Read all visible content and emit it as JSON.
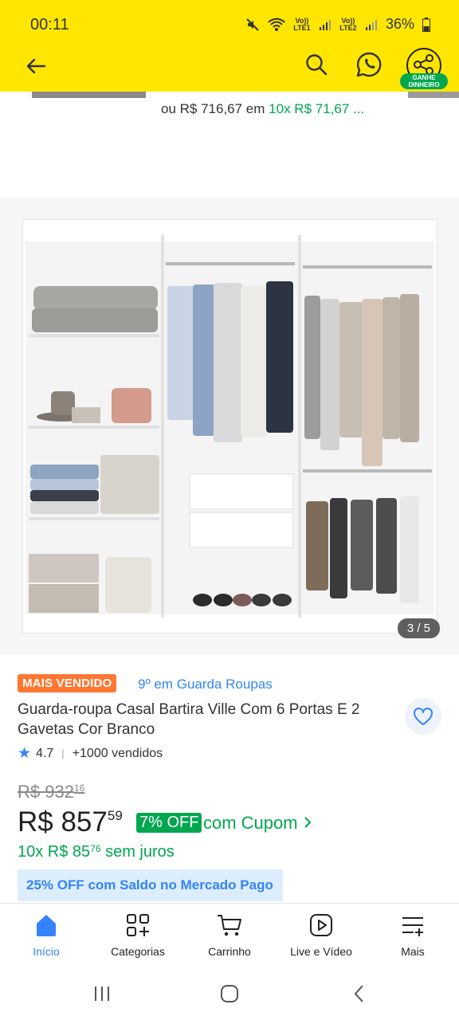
{
  "status_bar": {
    "time": "00:11",
    "lte1": "Vo)) LTE1",
    "lte2": "Vo)) LTE2",
    "battery": "36%"
  },
  "header": {
    "earn_badge": "GANHE DINHEIRO"
  },
  "installment_line": {
    "prefix": "ou R$ 716,67 em",
    "highlight": "10x R$ 71,67 ..."
  },
  "gallery": {
    "counter": "3 / 5"
  },
  "product": {
    "badge": "MAIS VENDIDO",
    "rank": "9º em Guarda Roupas",
    "title": "Guarda-roupa Casal Bartira Ville Com 6 Portas E 2 Gavetas Cor Branco",
    "rating": "4.7",
    "sold": "+1000 vendidos",
    "old_price": {
      "main": "R$ 932",
      "cents": "16"
    },
    "price": {
      "main": "R$ 857",
      "cents": "59"
    },
    "discount": "7% OFF",
    "coupon_link": "com Cupom",
    "installments": {
      "main": "10x R$ 85",
      "cents": "76",
      "suffix": "sem juros"
    },
    "promo": "25% OFF com Saldo no Mercado Pago"
  },
  "bottom_nav": [
    {
      "label": "Início",
      "icon": "home-icon",
      "active": true
    },
    {
      "label": "Categorias",
      "icon": "categories-icon",
      "active": false
    },
    {
      "label": "Carrinho",
      "icon": "cart-icon",
      "active": false
    },
    {
      "label": "Live e Vídeo",
      "icon": "video-icon",
      "active": false
    },
    {
      "label": "Mais",
      "icon": "menu-more-icon",
      "active": false
    }
  ],
  "colors": {
    "header": "#FFE600",
    "accent_blue": "#3483FA",
    "green": "#00A650",
    "badge_orange": "#FF7733"
  }
}
